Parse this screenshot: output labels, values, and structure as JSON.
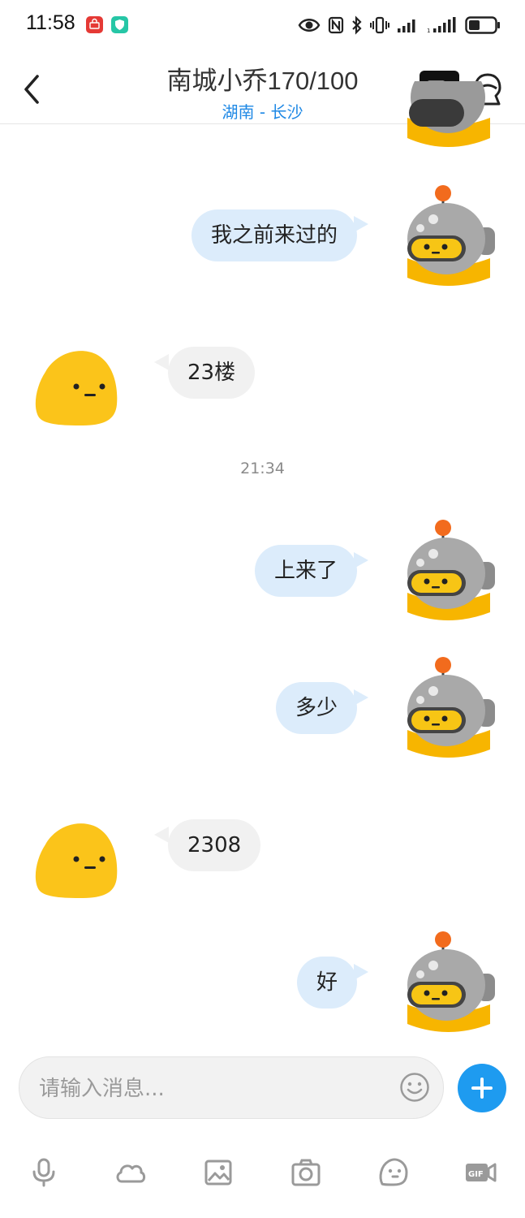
{
  "status_bar": {
    "time": "11:58",
    "icons": [
      "huawei-app-icon",
      "shield-app-icon",
      "eye-icon",
      "nfc-icon",
      "bluetooth-icon",
      "vibrate-icon",
      "signal-icon",
      "signal-icon",
      "battery-icon"
    ]
  },
  "header": {
    "title": "南城小乔170/100",
    "subtitle": "湖南 - 长沙"
  },
  "messages": [
    {
      "side": "me",
      "text": "我之前来过的"
    },
    {
      "side": "them",
      "text": "23楼"
    },
    {
      "side": "me",
      "text": "上来了"
    },
    {
      "side": "me",
      "text": "多少"
    },
    {
      "side": "them",
      "text": "2308"
    },
    {
      "side": "me",
      "text": "好"
    }
  ],
  "timestamp": "21:34",
  "composer": {
    "placeholder": "请输入消息..."
  },
  "toolbar": {
    "items": [
      "microphone-icon",
      "cloud-icon",
      "image-icon",
      "camera-icon",
      "sticker-icon",
      "gif-icon"
    ]
  },
  "colors": {
    "accent": "#1e9bf0",
    "my_bubble": "#dcecfb",
    "their_bubble": "#f1f1f1",
    "subtitle": "#1e88e5"
  }
}
